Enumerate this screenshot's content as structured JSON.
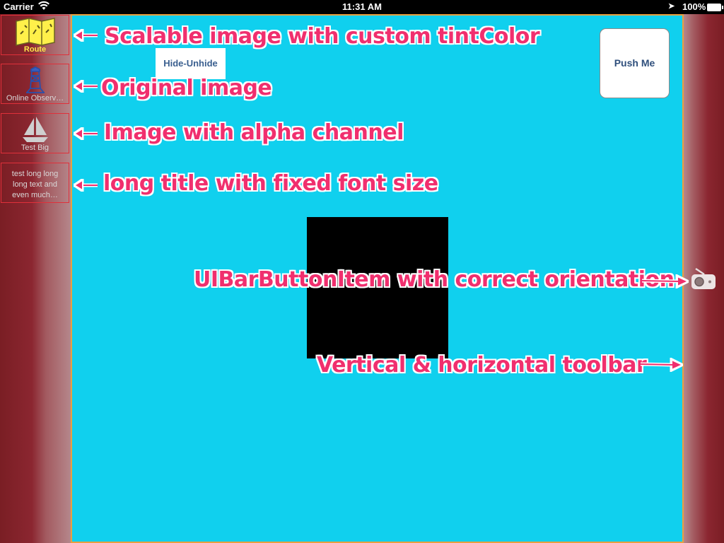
{
  "status_bar": {
    "carrier": "Carrier",
    "time": "11:31 AM",
    "battery": "100%"
  },
  "left_toolbar": {
    "items": [
      {
        "label": "Route",
        "icon": "map-icon",
        "tint": "#ffe94a"
      },
      {
        "label": "Online Observ…",
        "icon": "tower-icon"
      },
      {
        "label": "Test Big",
        "icon": "sailboat-icon"
      },
      {
        "label": "test long long long text and even much…"
      }
    ]
  },
  "right_toolbar": {
    "items": [
      {
        "icon": "radio-icon"
      }
    ]
  },
  "main": {
    "hide_button": "Hide-Unhide",
    "push_button": "Push Me",
    "background": "#10d0ee"
  },
  "annotations": {
    "scalable": "Scalable image with custom tintColor",
    "original": "Original image",
    "alpha": "Image with alpha channel",
    "long_title": "long title with fixed font size",
    "barbutton": "UIBarButtonItem with correct orientation",
    "toolbar": "Vertical & horizontal toolbar"
  },
  "colors": {
    "toolbar": "#8b2630",
    "annotation": "#f02f6e",
    "border": "#e0303a"
  }
}
